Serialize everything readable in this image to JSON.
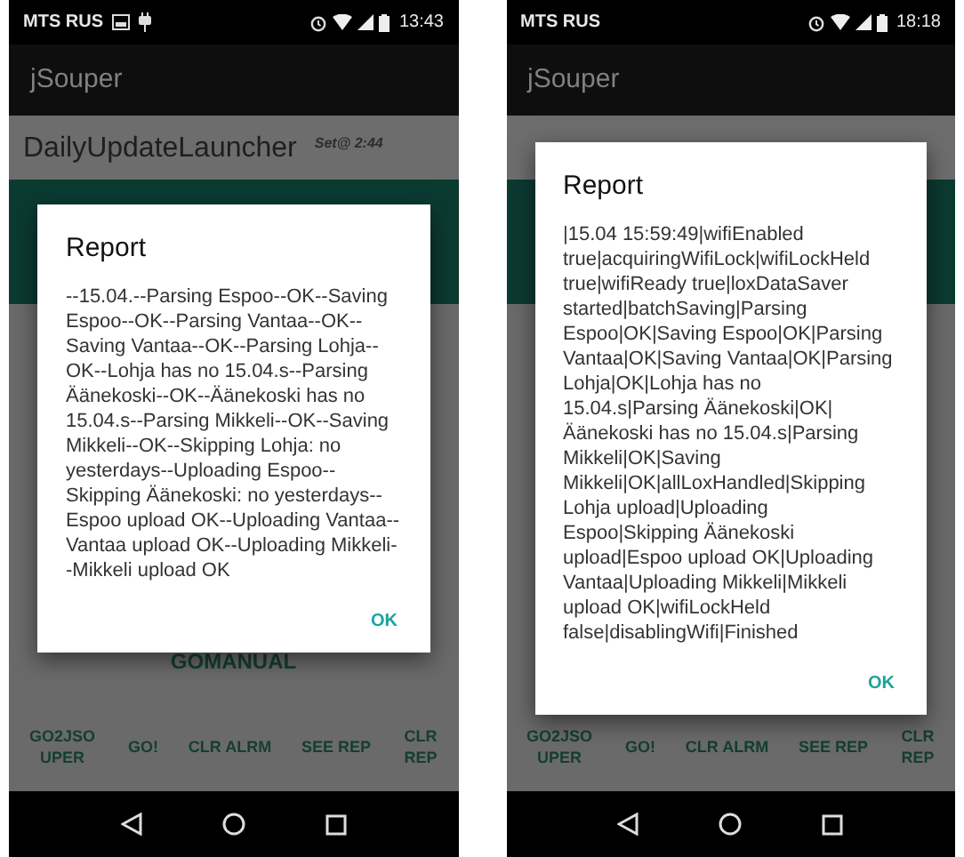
{
  "phones": [
    {
      "status_bar": {
        "carrier": "MTS RUS",
        "notification_icons": true,
        "time": "13:43"
      },
      "app_title": "jSouper",
      "header": {
        "title": "DailyUpdateLauncher",
        "schedule": "Set@ 2:44"
      },
      "main_button": "GOMANUAL",
      "buttons": [
        "GO2JSOUPER",
        "GO!",
        "CLR ALRM",
        "SEE REP",
        "CLR REP"
      ],
      "dialog": {
        "title": "Report",
        "message": "--15.04.--Parsing Espoo--OK--Saving Espoo--OK--Parsing Vantaa--OK--Saving Vantaa--OK--Parsing Lohja--OK--Lohja has no 15.04.s--Parsing Äänekoski--OK--Äänekoski has no 15.04.s--Parsing Mikkeli--OK--Saving Mikkeli--OK--Skipping Lohja: no yesterdays--Uploading Espoo--Skipping Äänekoski: no yesterdays--Espoo upload OK--Uploading Vantaa--Vantaa upload OK--Uploading Mikkeli--Mikkeli upload OK",
        "ok": "OK"
      }
    },
    {
      "status_bar": {
        "carrier": "MTS RUS",
        "notification_icons": false,
        "time": "18:18"
      },
      "app_title": "jSouper",
      "buttons": [
        "GO2JSOUPER",
        "GO!",
        "CLR ALRM",
        "SEE REP",
        "CLR REP"
      ],
      "dialog": {
        "title": "Report",
        "message": "|15.04 15:59:49|wifiEnabled true|acquiringWifiLock|wifiLockHeld true|wifiReady true|loxDataSaver started|batchSaving|Parsing Espoo|OK|Saving Espoo|OK|Parsing Vantaa|OK|Saving Vantaa|OK|Parsing Lohja|OK|Lohja has no 15.04.s|Parsing Äänekoski|OK|Äänekoski has no 15.04.s|Parsing Mikkeli|OK|Saving Mikkeli|OK|allLoxHandled|Skipping Lohja upload|Uploading Espoo|Skipping Äänekoski upload|Espoo upload OK|Uploading Vantaa|Uploading Mikkeli|Mikkeli upload OK|wifiLockHeld false|disablingWifi|Finished",
        "ok": "OK"
      }
    }
  ]
}
